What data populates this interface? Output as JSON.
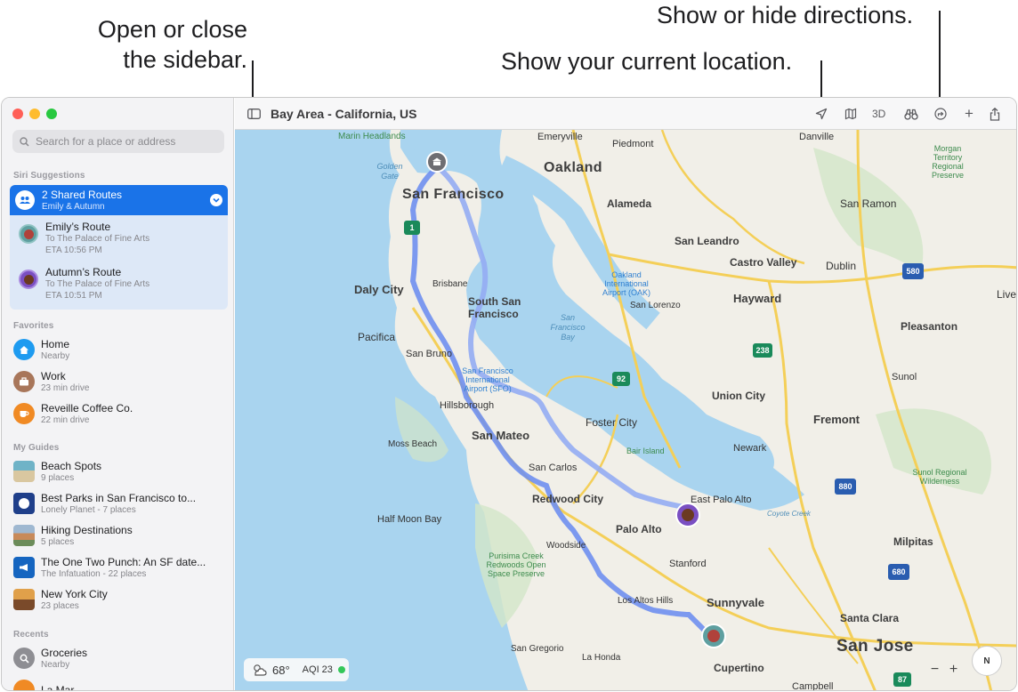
{
  "callouts": {
    "sidebar": [
      "Open or close",
      "the sidebar."
    ],
    "location": "Show your current location.",
    "directions": "Show or hide directions."
  },
  "window": {
    "title": "Bay Area - California, US",
    "toolbar": {
      "sidebar_icon": "sidebar-icon",
      "location_icon": "location-arrow-icon",
      "map_mode_icon": "map-icon",
      "three_d_label": "3D",
      "look_around_icon": "binoculars-icon",
      "directions_icon": "directions-icon",
      "add_icon": "plus-icon",
      "share_icon": "share-icon"
    }
  },
  "sidebar": {
    "search_placeholder": "Search for a place or address",
    "siri_suggestions_header": "Siri Suggestions",
    "shared": {
      "title": "2 Shared Routes",
      "subtitle": "Emily & Autumn",
      "routes": [
        {
          "name": "Emily’s Route",
          "dest": "To The Palace of Fine Arts",
          "eta": "ETA 10:56 PM"
        },
        {
          "name": "Autumn’s Route",
          "dest": "To The Palace of Fine Arts",
          "eta": "ETA 10:51 PM"
        }
      ]
    },
    "favorites_header": "Favorites",
    "favorites": [
      {
        "title": "Home",
        "sub": "Nearby",
        "icon": "house-icon",
        "color": "#1e9bf0"
      },
      {
        "title": "Work",
        "sub": "23 min drive",
        "icon": "briefcase-icon",
        "color": "#a8765a"
      },
      {
        "title": "Reveille Coffee Co.",
        "sub": "22 min drive",
        "icon": "cup-icon",
        "color": "#f08a24"
      }
    ],
    "guides_header": "My Guides",
    "guides": [
      {
        "title": "Beach Spots",
        "sub": "9 places",
        "color": "#3c7f74"
      },
      {
        "title": "Best Parks in San Francisco to...",
        "sub": "Lonely Planet - 7 places",
        "color": "#1f3f8a"
      },
      {
        "title": "Hiking Destinations",
        "sub": "5 places",
        "color": "#7a8fa8"
      },
      {
        "title": "The One Two Punch: An SF date...",
        "sub": "The Infatuation - 22 places",
        "color": "#1565c0"
      },
      {
        "title": "New York City",
        "sub": "23 places",
        "color": "#c97a2c"
      }
    ],
    "recents_header": "Recents",
    "recents": [
      {
        "title": "Groceries",
        "sub": "Nearby",
        "icon": "search-icon",
        "color": "#8e8e93"
      },
      {
        "title": "La Mar",
        "sub": "",
        "icon": "fork-icon",
        "color": "#f08a24"
      }
    ]
  },
  "map": {
    "cities_big": [
      "Oakland",
      "San Francisco",
      "San Jose"
    ],
    "cities_md": [
      "Daly City",
      "South San Francisco",
      "Hayward",
      "San Mateo",
      "Fremont",
      "Redwood City",
      "Union City",
      "Sunnyvale",
      "Palo Alto",
      "Foster City",
      "Santa Clara",
      "Milpitas",
      "Pleasanton",
      "Cupertino",
      "Alameda",
      "San Leandro",
      "Castro Valley",
      "San Ramon",
      "Dublin",
      "Pacifica",
      "Livermore"
    ],
    "cities_sm": [
      "Emeryville",
      "Piedmont",
      "Danville",
      "Marin Headlands",
      "Brisbane",
      "San Lorenzo",
      "San Bruno",
      "Hillsborough",
      "Moss Beach",
      "San Carlos",
      "Half Moon Bay",
      "East Palo Alto",
      "Newark",
      "Sunol",
      "Woodside",
      "Stanford",
      "Los Altos Hills",
      "San Gregorio",
      "La Honda",
      "Campbell"
    ],
    "water": [
      "Golden Gate",
      "San Francisco Bay",
      "Coyote Creek"
    ],
    "airports": [
      "Oakland International Airport (OAK)",
      "San Francisco International Airport (SFO)"
    ],
    "parks": [
      "Morgan Territory Regional Preserve",
      "Bair Island",
      "Sunol Regional Wilderness",
      "Purisima Creek Redwoods Open Space Preserve"
    ],
    "shields": [
      "1",
      "92",
      "238",
      "580",
      "880",
      "680",
      "87"
    ]
  },
  "overlay": {
    "weather_icon": "partly-cloudy-icon",
    "temperature": "68°",
    "aqi": "AQI 23",
    "aqi_color": "#34c759",
    "zoom_out": "−",
    "zoom_in": "+",
    "compass": "N"
  }
}
